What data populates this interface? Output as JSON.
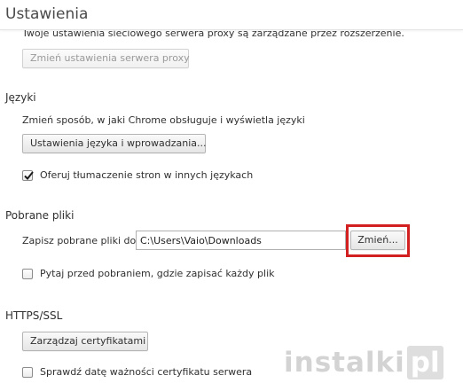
{
  "header": {
    "title": "Ustawienia"
  },
  "proxy": {
    "clipped_text": "Twoje ustawienia sieciowego serwera proxy są zarządzane przez rozszerzenie.",
    "button_label": "Zmień ustawienia serwera proxy"
  },
  "languages": {
    "title": "Języki",
    "description": "Zmień sposób, w jaki Chrome obsługuje i wyświetla języki",
    "button_label": "Ustawienia języka i wprowadzania...",
    "translate_checkbox_label": "Oferuj tłumaczenie stron w innych językach",
    "translate_checked": true
  },
  "downloads": {
    "title": "Pobrane pliki",
    "save_to_label": "Zapisz pobrane pliki do:",
    "path_value": "C:\\Users\\Vaio\\Downloads",
    "change_button_label": "Zmień...",
    "ask_checkbox_label": "Pytaj przed pobraniem, gdzie zapisać każdy plik",
    "ask_checked": false
  },
  "https": {
    "title": "HTTPS/SSL",
    "button_label": "Zarządzaj certyfikatami",
    "revocation_checkbox_label": "Sprawdź datę ważności certyfikatu serwera",
    "revocation_checked": false
  },
  "watermark": {
    "text": "instalki",
    "box_text": "pl"
  },
  "colors": {
    "highlight": "#d21f1f"
  }
}
